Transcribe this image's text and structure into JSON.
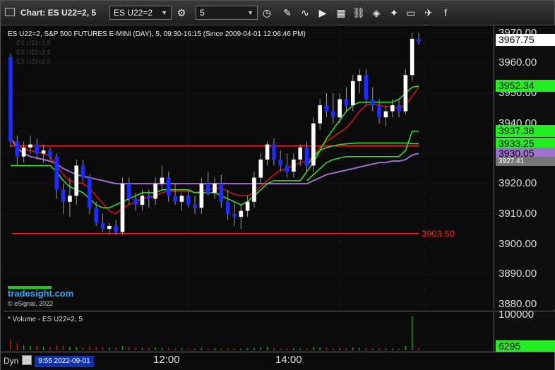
{
  "window": {
    "title": "Chart: ES U22=2, 5",
    "symbol_value": "ES U22=2",
    "interval_value": "5",
    "toolbar_icons": [
      "settings-icon",
      "clock-icon",
      "pencil-icon",
      "line-study-icon",
      "play-icon",
      "studies-icon",
      "link-icon",
      "tag-icon",
      "chat-icon",
      "twitter-icon",
      "facebook-icon"
    ]
  },
  "colors": {
    "up": "#ffffff",
    "down": "#1a2cff",
    "fast_ma": "#e01010",
    "slow_ma": "#a06fd0",
    "band": "#22ee22",
    "level": "#ff2020",
    "vol_up": "#00b400",
    "vol_down": "#d01010"
  },
  "chart_data": {
    "type": "candlestick",
    "title": "ES U22=2, S&P 500 FUTURES E-MINI (DAY), 5, 09:30-16:15 (Since 2009-04-01 12:06:46 PM)",
    "ghost_lines": [
      "ES U22=2,5",
      "ES U22=2,5",
      "ES U22=2,5"
    ],
    "ylim": [
      3880,
      3972
    ],
    "y_ticks": [
      "3970.00",
      "3960.00",
      "3950.00",
      "3940.00",
      "3930.00",
      "3920.00",
      "3910.00",
      "3900.00",
      "3890.00",
      "3880.00"
    ],
    "x_ticks": [
      "12:00",
      "14:00"
    ],
    "bars": [
      [
        3962,
        3963,
        3932,
        3934
      ],
      [
        3934,
        3936,
        3926,
        3929
      ],
      [
        3929,
        3934,
        3927,
        3932
      ],
      [
        3932,
        3936,
        3930,
        3933
      ],
      [
        3933,
        3935,
        3928,
        3930
      ],
      [
        3930,
        3933,
        3927,
        3931
      ],
      [
        3931,
        3932,
        3928,
        3929
      ],
      [
        3929,
        3930,
        3915,
        3918
      ],
      [
        3918,
        3920,
        3910,
        3914
      ],
      [
        3914,
        3922,
        3909,
        3916
      ],
      [
        3916,
        3928,
        3913,
        3926
      ],
      [
        3926,
        3928,
        3920,
        3922
      ],
      [
        3922,
        3923,
        3910,
        3912
      ],
      [
        3912,
        3914,
        3906,
        3907
      ],
      [
        3907,
        3910,
        3904,
        3905
      ],
      [
        3905,
        3907,
        3903,
        3906
      ],
      [
        3906,
        3908,
        3903,
        3904
      ],
      [
        3904,
        3922,
        3903,
        3920
      ],
      [
        3920,
        3922,
        3913,
        3915
      ],
      [
        3915,
        3917,
        3911,
        3913
      ],
      [
        3913,
        3918,
        3911,
        3916
      ],
      [
        3916,
        3918,
        3912,
        3915
      ],
      [
        3915,
        3922,
        3913,
        3920
      ],
      [
        3920,
        3926,
        3918,
        3922
      ],
      [
        3922,
        3924,
        3914,
        3916
      ],
      [
        3916,
        3920,
        3913,
        3914
      ],
      [
        3914,
        3917,
        3911,
        3916
      ],
      [
        3916,
        3918,
        3912,
        3913
      ],
      [
        3913,
        3916,
        3910,
        3912
      ],
      [
        3912,
        3922,
        3910,
        3920
      ],
      [
        3920,
        3924,
        3916,
        3917
      ],
      [
        3917,
        3922,
        3915,
        3920
      ],
      [
        3920,
        3923,
        3912,
        3914
      ],
      [
        3914,
        3918,
        3908,
        3910
      ],
      [
        3910,
        3914,
        3906,
        3909
      ],
      [
        3909,
        3913,
        3905,
        3911
      ],
      [
        3911,
        3916,
        3909,
        3914
      ],
      [
        3914,
        3924,
        3912,
        3922
      ],
      [
        3922,
        3930,
        3920,
        3928
      ],
      [
        3928,
        3934,
        3926,
        3933
      ],
      [
        3933,
        3935,
        3926,
        3928
      ],
      [
        3928,
        3931,
        3924,
        3926
      ],
      [
        3926,
        3930,
        3922,
        3924
      ],
      [
        3924,
        3930,
        3922,
        3928
      ],
      [
        3928,
        3933,
        3926,
        3932
      ],
      [
        3932,
        3934,
        3924,
        3926
      ],
      [
        3926,
        3942,
        3924,
        3940
      ],
      [
        3940,
        3948,
        3938,
        3946
      ],
      [
        3946,
        3950,
        3942,
        3944
      ],
      [
        3944,
        3950,
        3940,
        3942
      ],
      [
        3942,
        3950,
        3940,
        3948
      ],
      [
        3948,
        3952,
        3944,
        3946
      ],
      [
        3946,
        3956,
        3944,
        3954
      ],
      [
        3954,
        3958,
        3950,
        3956
      ],
      [
        3956,
        3958,
        3946,
        3948
      ],
      [
        3948,
        3952,
        3944,
        3946
      ],
      [
        3946,
        3948,
        3940,
        3942
      ],
      [
        3942,
        3946,
        3939,
        3944
      ],
      [
        3944,
        3948,
        3942,
        3946
      ],
      [
        3946,
        3948,
        3942,
        3944
      ],
      [
        3944,
        3958,
        3943,
        3956
      ],
      [
        3956,
        3970,
        3954,
        3968
      ],
      [
        3968,
        3970,
        3966,
        3967
      ]
    ],
    "ma_fast": [
      3935,
      3933,
      3931.5,
      3931,
      3930.5,
      3930,
      3929,
      3926,
      3923,
      3921,
      3920.5,
      3920,
      3918.5,
      3916,
      3913.5,
      3911,
      3910,
      3912,
      3913,
      3914,
      3915,
      3915.5,
      3916,
      3917,
      3917.5,
      3917.5,
      3917.5,
      3917.5,
      3917,
      3917.5,
      3918,
      3918.5,
      3918.5,
      3917.5,
      3916.5,
      3916,
      3916,
      3917,
      3919,
      3921,
      3923,
      3924.5,
      3925,
      3926,
      3927,
      3927.5,
      3929,
      3932,
      3934,
      3935.5,
      3937,
      3938.5,
      3941,
      3944,
      3946,
      3946.5,
      3946,
      3945.5,
      3945.5,
      3945,
      3946,
      3949,
      3952
    ],
    "ma_slow": [
      3935,
      3932,
      3930,
      3929,
      3928.5,
      3928,
      3927.5,
      3926.5,
      3925,
      3924,
      3923,
      3922.5,
      3922,
      3921.5,
      3921,
      3920.5,
      3920,
      3920,
      3920,
      3920,
      3920,
      3920,
      3920,
      3920,
      3920,
      3920,
      3920,
      3920,
      3920,
      3920,
      3920,
      3920,
      3920,
      3920,
      3920,
      3920,
      3920,
      3920,
      3920,
      3920,
      3920,
      3920,
      3920,
      3920,
      3920,
      3920,
      3921,
      3922,
      3923,
      3923.5,
      3924,
      3924.5,
      3925,
      3925.5,
      3926,
      3926.5,
      3927,
      3927,
      3927.5,
      3927.5,
      3928,
      3929.5,
      3930
    ],
    "band_upper": [
      null,
      null,
      null,
      null,
      null,
      null,
      null,
      null,
      null,
      null,
      null,
      null,
      null,
      null,
      null,
      null,
      null,
      null,
      null,
      null,
      null,
      null,
      null,
      null,
      null,
      null,
      null,
      null,
      null,
      null,
      null,
      null,
      null,
      null,
      null,
      null,
      null,
      null,
      null,
      null,
      null,
      null,
      null,
      null,
      null,
      3926,
      3929,
      3931,
      3932,
      3932.5,
      3933,
      3933.2,
      3933.4,
      3933.5,
      3933.5,
      3933.5,
      3933.5,
      3933.5,
      3933.5,
      3933.5,
      3933.5,
      3933.25,
      3933.25
    ],
    "band_lower": [
      null,
      null,
      null,
      null,
      null,
      null,
      null,
      null,
      null,
      null,
      null,
      null,
      null,
      null,
      null,
      null,
      null,
      null,
      null,
      null,
      null,
      null,
      null,
      null,
      null,
      null,
      null,
      null,
      null,
      null,
      null,
      null,
      null,
      null,
      null,
      null,
      null,
      null,
      null,
      null,
      null,
      null,
      null,
      null,
      null,
      3921,
      3923,
      3925,
      3927,
      3928,
      3928.5,
      3929,
      3929,
      3929,
      3929,
      3929,
      3929,
      3929,
      3929,
      3929,
      3931,
      3937.38,
      3937.38
    ],
    "bb_mid": [
      null,
      null,
      null,
      null,
      null,
      null,
      null,
      null,
      null,
      null,
      null,
      null,
      null,
      null,
      null,
      null,
      null,
      null,
      null,
      null,
      null,
      null,
      null,
      null,
      null,
      null,
      null,
      null,
      null,
      null,
      null,
      null,
      null,
      null,
      null,
      null,
      null,
      null,
      null,
      null,
      null,
      null,
      null,
      null,
      null,
      null,
      null,
      null,
      null,
      null,
      null,
      null,
      null,
      null,
      null,
      null,
      null,
      null,
      null,
      null,
      null,
      null,
      null
    ],
    "green_trend": [
      3926,
      3926,
      3926,
      3926,
      3926,
      3926,
      3926,
      3924,
      3921,
      3919,
      3918,
      3917,
      3915,
      3913,
      3912,
      3912,
      3913,
      3914,
      3915,
      3916,
      3917,
      3917,
      3917,
      3918,
      3918,
      3918,
      3918,
      3918,
      3917,
      3917,
      3917,
      3917,
      3916,
      3915,
      3914,
      3913,
      3914,
      3916,
      3918,
      3920,
      3921,
      3921,
      3921,
      3921,
      3921,
      3924,
      3927,
      3931,
      3935,
      3938,
      3941,
      3944,
      3946,
      3947,
      3947,
      3947,
      3947,
      3947,
      3947,
      3948,
      3950,
      3952,
      3952.34
    ],
    "levels": [
      {
        "value": 3932.5,
        "label": ""
      },
      {
        "value": 3903.5,
        "label": "3903.50"
      }
    ],
    "last_price": "3967.75",
    "price_tags": [
      {
        "label": "3967.75",
        "value": 3967.75,
        "bg": "#ffffff",
        "fg": "#000000",
        "size": "big"
      },
      {
        "label": "3952.34",
        "value": 3952.34,
        "bg": "#22ee22",
        "fg": "#000000",
        "size": "big"
      },
      {
        "label": "3937.38",
        "value": 3937.38,
        "bg": "#22ee22",
        "fg": "#000000",
        "size": "big"
      },
      {
        "label": "3933.25",
        "value": 3933.25,
        "bg": "#22ee22",
        "fg": "#000000",
        "size": "big"
      },
      {
        "label": "3930.05",
        "value": 3930.05,
        "bg": "#a06fd0",
        "fg": "#000000",
        "size": "big"
      },
      {
        "label": "3927.41",
        "value": 3927.41,
        "bg": "#777777",
        "fg": "#ffffff",
        "size": "small"
      }
    ],
    "volume": {
      "title": "* Volume - ES U22=2, 5",
      "ticks": [
        "100000"
      ],
      "last": "6295",
      "ylim": [
        0,
        100000
      ],
      "values": [
        30000,
        18000,
        14000,
        12000,
        11000,
        10000,
        9000,
        14000,
        12000,
        10000,
        9000,
        8000,
        10000,
        9000,
        9500,
        8000,
        7000,
        12000,
        8000,
        7000,
        6500,
        6000,
        7000,
        6500,
        6000,
        5500,
        6000,
        5500,
        5000,
        7000,
        5000,
        6000,
        5000,
        5500,
        5000,
        4500,
        5000,
        7000,
        8000,
        9000,
        6000,
        5000,
        5500,
        6000,
        5000,
        5000,
        9000,
        8000,
        7000,
        6000,
        6000,
        5500,
        8000,
        7000,
        6000,
        5500,
        6000,
        5500,
        5000,
        5000,
        12000,
        95000,
        6295
      ],
      "up": [
        0,
        0,
        1,
        1,
        0,
        1,
        0,
        0,
        0,
        1,
        1,
        0,
        0,
        0,
        0,
        1,
        0,
        1,
        0,
        0,
        1,
        0,
        1,
        1,
        0,
        0,
        1,
        0,
        0,
        1,
        0,
        1,
        0,
        0,
        0,
        1,
        1,
        1,
        1,
        1,
        0,
        0,
        0,
        1,
        1,
        0,
        1,
        1,
        0,
        0,
        1,
        0,
        1,
        1,
        0,
        0,
        0,
        1,
        1,
        0,
        1,
        1,
        0
      ]
    }
  },
  "footer": {
    "mode": "Dyn",
    "cursor_date": "9:55 2022-09-01",
    "logo": "tradesight.com",
    "copyright": "© eSignal, 2022"
  }
}
